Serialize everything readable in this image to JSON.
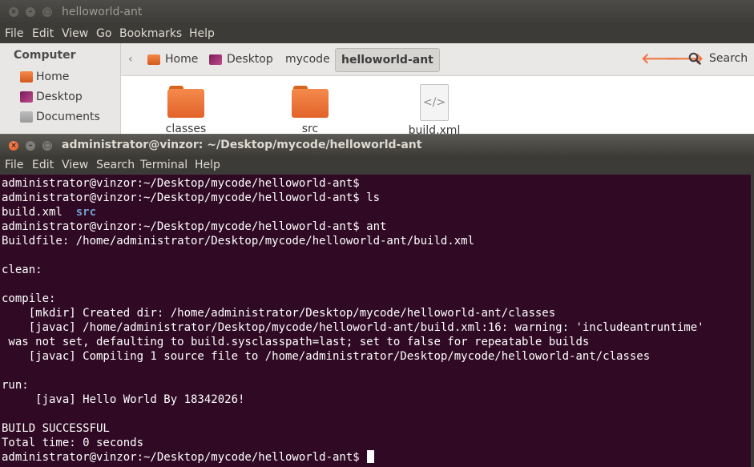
{
  "file_manager": {
    "title": "helloworld-ant",
    "menu": [
      "File",
      "Edit",
      "View",
      "Go",
      "Bookmarks",
      "Help"
    ],
    "sidebar": {
      "heading": "Computer",
      "items": [
        {
          "label": "Home",
          "icon": "home-folder-icon"
        },
        {
          "label": "Desktop",
          "icon": "desktop-icon"
        },
        {
          "label": "Documents",
          "icon": "documents-folder-icon"
        }
      ]
    },
    "breadcrumbs": [
      {
        "label": "Home",
        "icon": "home-folder-icon"
      },
      {
        "label": "Desktop",
        "icon": "desktop-icon"
      },
      {
        "label": "mycode"
      },
      {
        "label": "helloworld-ant",
        "active": true
      }
    ],
    "search_label": "Search",
    "files": [
      {
        "name": "classes",
        "type": "folder"
      },
      {
        "name": "src",
        "type": "folder"
      },
      {
        "name": "build.xml",
        "type": "xml-file",
        "glyph": "</>"
      }
    ],
    "accent_color": "#f07746"
  },
  "terminal": {
    "title": "administrator@vinzor: ~/Desktop/mycode/helloworld-ant",
    "menu": [
      "File",
      "Edit",
      "View",
      "Search",
      "Terminal",
      "Help"
    ],
    "background_color": "#300a24",
    "directory_color": "#729fcf",
    "lines": [
      "administrator@vinzor:~/Desktop/mycode/helloworld-ant$",
      "administrator@vinzor:~/Desktop/mycode/helloworld-ant$ ls",
      {
        "file": "build.xml",
        "dir": "src"
      },
      "administrator@vinzor:~/Desktop/mycode/helloworld-ant$ ant",
      "Buildfile: /home/administrator/Desktop/mycode/helloworld-ant/build.xml",
      "",
      "clean:",
      "",
      "compile:",
      "    [mkdir] Created dir: /home/administrator/Desktop/mycode/helloworld-ant/classes",
      "    [javac] /home/administrator/Desktop/mycode/helloworld-ant/build.xml:16: warning: 'includeantruntime'",
      " was not set, defaulting to build.sysclasspath=last; set to false for repeatable builds",
      "    [javac] Compiling 1 source file to /home/administrator/Desktop/mycode/helloworld-ant/classes",
      "",
      "run:",
      "     [java] Hello World By 18342026!",
      "",
      "BUILD SUCCESSFUL",
      "Total time: 0 seconds",
      "administrator@vinzor:~/Desktop/mycode/helloworld-ant$ "
    ]
  }
}
